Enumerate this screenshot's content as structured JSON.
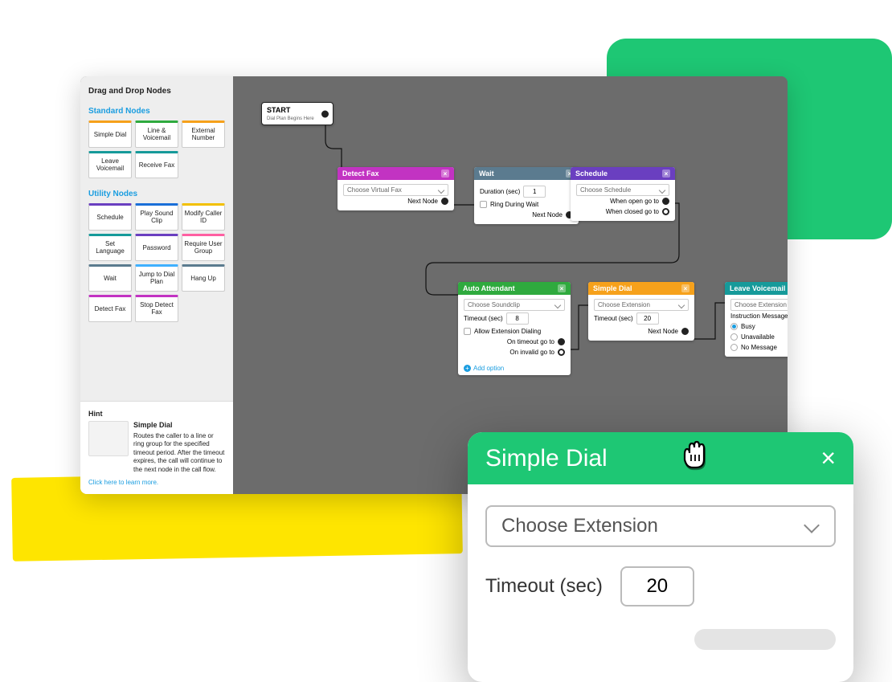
{
  "sidebar": {
    "title": "Drag and Drop Nodes",
    "standard_title": "Standard Nodes",
    "utility_title": "Utility Nodes",
    "standard": [
      {
        "label": "Simple Dial",
        "cls": "c-orange"
      },
      {
        "label": "Line & Voicemail",
        "cls": "c-green"
      },
      {
        "label": "External Number",
        "cls": "c-orange"
      },
      {
        "label": "Leave Voicemail",
        "cls": "c-teal"
      },
      {
        "label": "Receive Fax",
        "cls": "c-teal"
      }
    ],
    "utility": [
      {
        "label": "Schedule",
        "cls": "c-purple"
      },
      {
        "label": "Play Sound Clip",
        "cls": "c-blue"
      },
      {
        "label": "Modify Caller ID",
        "cls": "c-yellow"
      },
      {
        "label": "Set Language",
        "cls": "c-teal"
      },
      {
        "label": "Password",
        "cls": "c-purple"
      },
      {
        "label": "Require User Group",
        "cls": "c-pink"
      },
      {
        "label": "Wait",
        "cls": "c-slate"
      },
      {
        "label": "Jump to Dial Plan",
        "cls": "c-ltblue"
      },
      {
        "label": "Hang Up",
        "cls": "c-slate"
      },
      {
        "label": "Detect Fax",
        "cls": "c-magenta"
      },
      {
        "label": "Stop Detect Fax",
        "cls": "c-magenta"
      }
    ],
    "hint": {
      "title": "Hint",
      "node_name": "Simple Dial",
      "text": "Routes the caller to a line or ring group for the specified timeout period. After the timeout expires, the call will continue to the next node in the call flow.",
      "link": "Click here to learn more."
    }
  },
  "canvas": {
    "start": {
      "title": "START",
      "sub": "Dial Plan Begins Here"
    },
    "detect_fax": {
      "title": "Detect Fax",
      "select": "Choose Virtual Fax",
      "out": "Next Node"
    },
    "wait": {
      "title": "Wait",
      "duration_lbl": "Duration (sec)",
      "duration": "1",
      "ring": "Ring During Wait",
      "out": "Next Node"
    },
    "schedule": {
      "title": "Schedule",
      "select": "Choose Schedule",
      "open": "When open go to",
      "closed": "When closed go to"
    },
    "auto": {
      "title": "Auto Attendant",
      "select": "Choose Soundclip",
      "timeout_lbl": "Timeout (sec)",
      "timeout": "8",
      "allow": "Allow Extension Dialing",
      "on_timeout": "On timeout go to",
      "on_invalid": "On invalid go to",
      "add": "Add option"
    },
    "simple": {
      "title": "Simple Dial",
      "select": "Choose Extension",
      "timeout_lbl": "Timeout (sec)",
      "timeout": "20",
      "out": "Next Node"
    },
    "voicemail": {
      "title": "Leave Voicemail",
      "select": "Choose Extension",
      "msg_lbl": "Instruction Message Type:",
      "opt1": "Busy",
      "opt2": "Unavailable",
      "opt3": "No Message"
    }
  },
  "dialog": {
    "title": "Simple Dial",
    "select": "Choose Extension",
    "timeout_lbl": "Timeout (sec)",
    "timeout": "20"
  },
  "colors": {
    "magenta": "#c233c2",
    "slate": "#5b7b8f",
    "purple": "#6a3fc0",
    "green": "#2faa3e",
    "orange": "#f6a11b",
    "teal": "#169a9a"
  }
}
